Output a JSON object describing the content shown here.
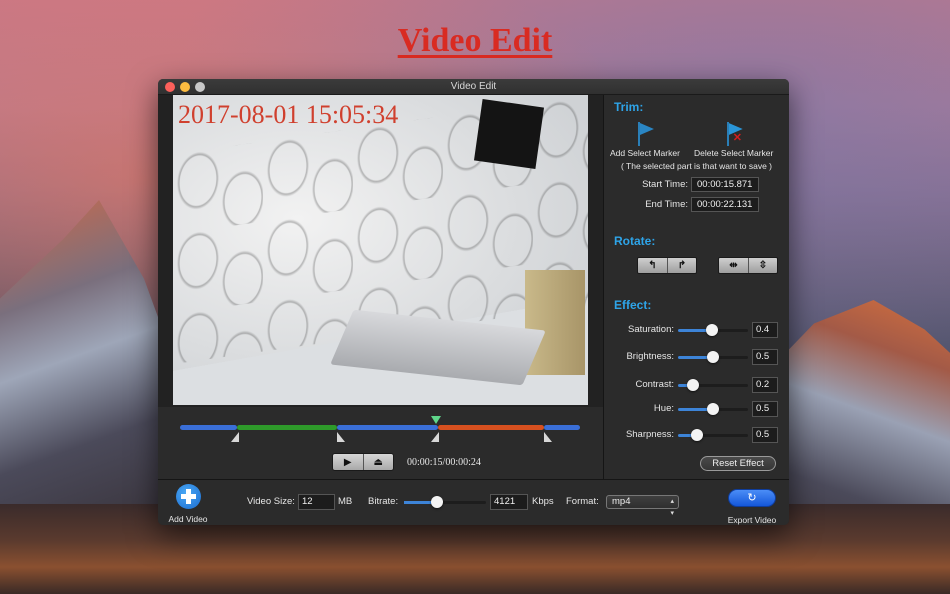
{
  "promo": {
    "title": "Video Edit"
  },
  "window": {
    "title": "Video Edit"
  },
  "video": {
    "timestamp_overlay": "2017-08-01 15:05:34"
  },
  "timeline": {
    "playhead_fraction": 0.64,
    "segments": [
      {
        "color": "#3a6fd8",
        "kind": "unselected"
      },
      {
        "color": "#2e9a2a",
        "kind": "selected"
      },
      {
        "color": "#3a6fd8",
        "kind": "unselected"
      },
      {
        "color": "#d6501f",
        "kind": "current-selection"
      },
      {
        "color": "#3a6fd8",
        "kind": "unselected"
      }
    ],
    "play_icon": "▶",
    "play_selection_icon": "⏏",
    "time_readout": "00:00:15/00:00:24"
  },
  "trim": {
    "title": "Trim:",
    "add_marker_label": "Add Select Marker",
    "delete_marker_label": "Delete Select Marker",
    "note": "( The selected part is that want to save )",
    "start_label": "Start Time:",
    "start_value": "00:00:15.871",
    "end_label": "End Time:",
    "end_value": "00:00:22.131",
    "flag_color": "#2a86c4"
  },
  "rotate": {
    "title": "Rotate:",
    "buttons": [
      {
        "name": "rotate-left",
        "icon": "↰"
      },
      {
        "name": "rotate-right",
        "icon": "↱"
      },
      {
        "name": "flip-horizontal",
        "icon": "⇹"
      },
      {
        "name": "flip-vertical",
        "icon": "⇳"
      }
    ]
  },
  "effect": {
    "title": "Effect:",
    "items": [
      {
        "label": "Saturation:",
        "value": "0.4",
        "fraction": 0.48
      },
      {
        "label": "Brightness:",
        "value": "0.5",
        "fraction": 0.5
      },
      {
        "label": "Contrast:",
        "value": "0.2",
        "fraction": 0.22
      },
      {
        "label": "Hue:",
        "value": "0.5",
        "fraction": 0.5
      },
      {
        "label": "Sharpness:",
        "value": "0.5",
        "fraction": 0.27
      }
    ],
    "reset_label": "Reset Effect"
  },
  "bottom": {
    "add_video_label": "Add Video",
    "video_size_label": "Video Size:",
    "video_size_value": "12",
    "video_size_unit": "MB",
    "bitrate_label": "Bitrate:",
    "bitrate_fraction": 0.4,
    "bitrate_value": "4121",
    "bitrate_unit": "Kbps",
    "format_label": "Format:",
    "format_value": "mp4",
    "export_icon": "↻",
    "export_label": "Export Video"
  },
  "colors": {
    "accent": "#2ea4e8",
    "slider_fill": "#3d84d8",
    "promo_title": "#d92b22",
    "timestamp": "#d0402e"
  }
}
